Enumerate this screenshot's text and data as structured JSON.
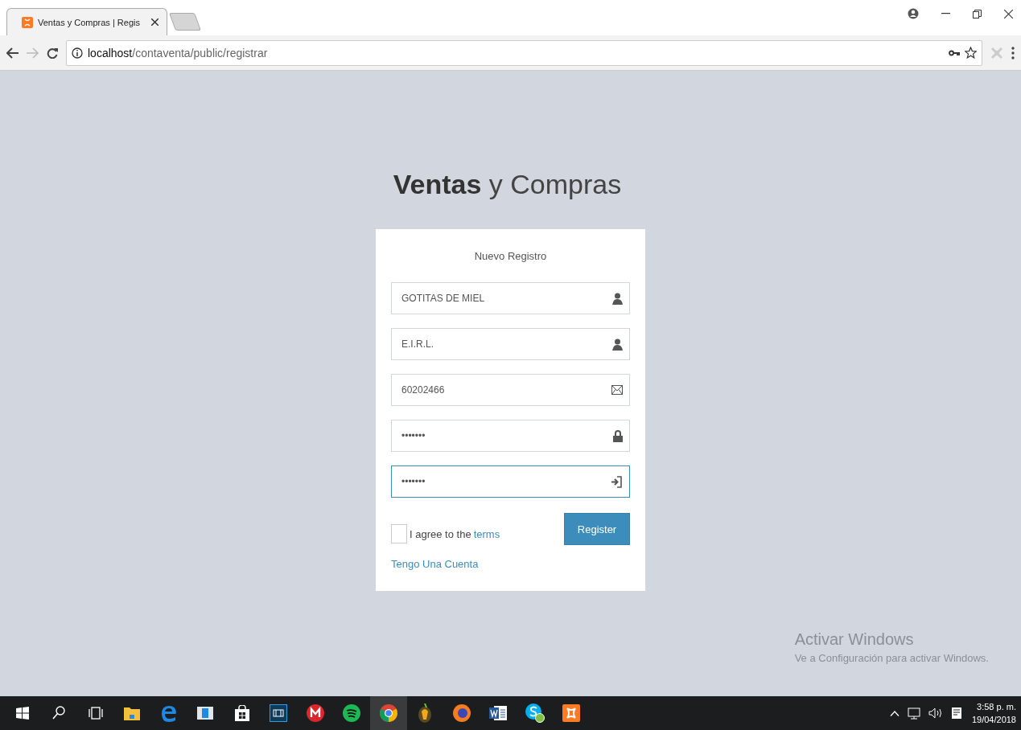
{
  "browser": {
    "tabs": [
      {
        "title": "Ventas y Compras | Regis",
        "selected": true
      }
    ],
    "address": {
      "host": "localhost",
      "path": "/contaventa/public/registrar"
    }
  },
  "page": {
    "logo": "**Ventas** y Compras",
    "box_title": "Nuevo Registro",
    "fields": [
      {
        "value": "GOTITAS DE MIEL",
        "kind": "user",
        "focused": false
      },
      {
        "value": "E.I.R.L.",
        "kind": "user",
        "focused": false
      },
      {
        "value": "60202466",
        "kind": "envelope",
        "focused": false
      },
      {
        "value": "•••••••",
        "kind": "lock",
        "focused": false
      },
      {
        "value": "•••••••",
        "kind": "signin",
        "focused": true
      }
    ],
    "agree": {
      "checked": false,
      "text": "I agree to the",
      "link": "terms"
    },
    "register_button": "Register",
    "login_link": "Tengo Una Cuenta"
  },
  "activation_notice": {
    "title": "Activar Windows",
    "subtitle": "Ve a Configuración para activar Windows."
  },
  "taskbar": {
    "apps": [
      {
        "kind": "start",
        "selected": false
      },
      {
        "kind": "search",
        "selected": false
      },
      {
        "kind": "taskview",
        "selected": false
      },
      {
        "kind": "folder",
        "selected": false
      },
      {
        "kind": "edge",
        "selected": false
      },
      {
        "kind": "window",
        "selected": false
      },
      {
        "kind": "store",
        "selected": false
      },
      {
        "kind": "film",
        "selected": false
      },
      {
        "kind": "mega",
        "selected": false
      },
      {
        "kind": "spotify",
        "selected": false
      },
      {
        "kind": "chrome",
        "selected": true
      },
      {
        "kind": "fruit",
        "selected": false
      },
      {
        "kind": "firefox",
        "selected": false
      },
      {
        "kind": "word",
        "selected": false
      },
      {
        "kind": "skype",
        "selected": false
      },
      {
        "kind": "xampp",
        "selected": false
      }
    ],
    "clock": {
      "time": "3:58 p. m.",
      "date": "19/04/2018"
    }
  }
}
